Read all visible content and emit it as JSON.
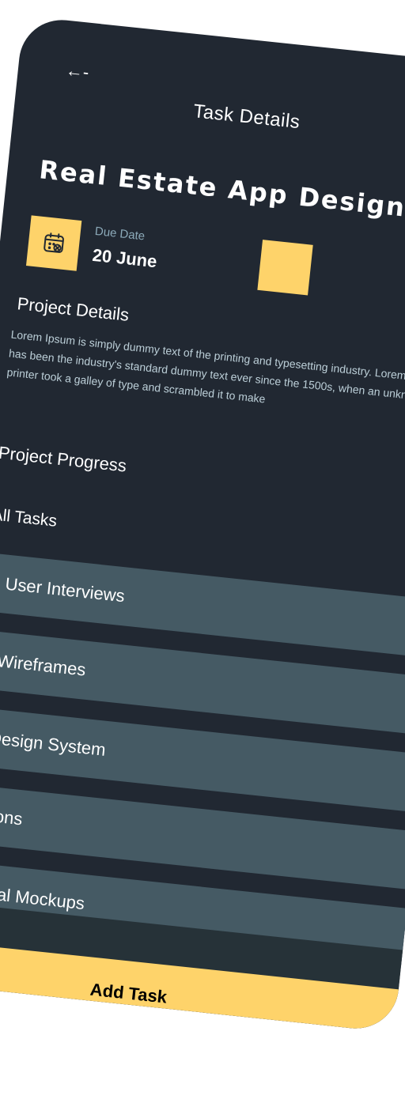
{
  "header": {
    "back_label": "←-",
    "title": "Task Details"
  },
  "project": {
    "title": "Real Estate App Design",
    "due_label": "Due Date",
    "due_value": "20 June"
  },
  "details": {
    "heading": "Project Details",
    "text": "Lorem Ipsum is simply dummy text of the printing and typesetting industry. Lorem Ipsum has been the industry's standard dummy text ever since the 1500s, when an unknown printer took a galley of type and scrambled it to make"
  },
  "progress": {
    "heading": "Project Progress"
  },
  "tasks": {
    "heading": "All Tasks",
    "items": [
      {
        "label": "User Interviews"
      },
      {
        "label": "Wireframes"
      },
      {
        "label": "Design System"
      },
      {
        "label": "Icons"
      },
      {
        "label": "Final Mockups"
      }
    ]
  },
  "footer": {
    "add_task_label": "Add Task"
  },
  "colors": {
    "background": "#212832",
    "accent": "#FED36A",
    "task_item": "#455A64",
    "muted_text": "#8CAAB9"
  },
  "icons": {
    "back": "arrow-left-icon",
    "calendar": "calendar-icon"
  }
}
